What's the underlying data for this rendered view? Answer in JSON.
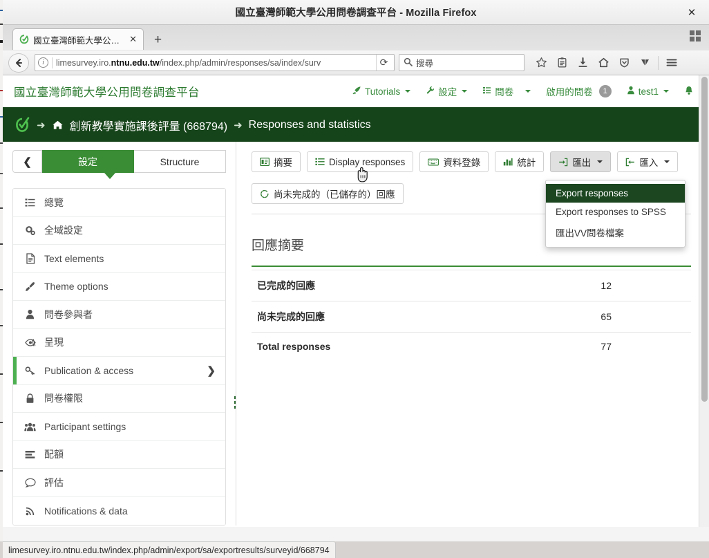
{
  "window": {
    "title": "國立臺灣師範大學公用問卷調查平台 - Mozilla Firefox",
    "close_label": "✕"
  },
  "browser": {
    "tab": {
      "title": "國立臺灣師範大學公…",
      "close_label": "✕",
      "favicon": "limesurvey-favicon-icon"
    },
    "new_tab_label": "+",
    "url": "limesurvey.iro.ntnu.edu.tw/index.php/admin/responses/sa/index/surv",
    "url_host_bold": "ntnu.edu.tw",
    "url_prefix": "limesurvey.iro.",
    "url_suffix": "/index.php/admin/responses/sa/index/surv",
    "reload_label": "⟳",
    "search_placeholder": "搜尋",
    "toolbar_icons": [
      "star-icon",
      "library-icon",
      "download-icon",
      "home-icon",
      "shield-icon",
      "pocket-icon",
      "hamburger-menu-icon"
    ]
  },
  "status_bar": {
    "link_preview": "limesurvey.iro.ntnu.edu.tw/index.php/admin/export/sa/exportresults/surveyid/668794"
  },
  "navbar": {
    "brand": "國立臺灣師範大學公用問卷調查平台",
    "items": [
      {
        "label": "Tutorials",
        "icon": "rocket-icon",
        "caret": true,
        "badge": null
      },
      {
        "label": "設定",
        "icon": "wrench-icon",
        "caret": true,
        "badge": null
      },
      {
        "label": "問卷",
        "icon": "list-icon",
        "caret": true,
        "badge": null
      },
      {
        "label": "啟用的問卷",
        "icon": null,
        "caret": false,
        "badge": "1"
      },
      {
        "label": "test1",
        "icon": "user-icon",
        "caret": true,
        "badge": null
      },
      {
        "label": "",
        "icon": "bell-icon",
        "caret": false,
        "badge": null
      }
    ]
  },
  "breadcrumb": {
    "logo": "limesurvey-logo-icon",
    "home_icon": "home-icon",
    "survey": "創新教學實施課後評量 (668794)",
    "current": "Responses and statistics",
    "separator": "➜"
  },
  "sidebar": {
    "collapse_label": "❮",
    "tabs": [
      {
        "label": "設定",
        "active": true
      },
      {
        "label": "Structure",
        "active": false
      }
    ],
    "items": [
      {
        "label": "總覽",
        "icon": "list-icon",
        "active": false,
        "chevron": false
      },
      {
        "label": "全域設定",
        "icon": "gears-icon",
        "active": false,
        "chevron": false
      },
      {
        "label": "Text elements",
        "icon": "file-text-icon",
        "active": false,
        "chevron": false
      },
      {
        "label": "Theme options",
        "icon": "paintbrush-icon",
        "active": false,
        "chevron": false
      },
      {
        "label": "問卷參與者",
        "icon": "user-icon",
        "active": false,
        "chevron": false
      },
      {
        "label": "呈現",
        "icon": "eye-slash-icon",
        "active": false,
        "chevron": false
      },
      {
        "label": "Publication & access",
        "icon": "key-icon",
        "active": true,
        "chevron": true
      },
      {
        "label": "問卷權限",
        "icon": "lock-icon",
        "active": false,
        "chevron": false
      },
      {
        "label": "Participant settings",
        "icon": "users-icon",
        "active": false,
        "chevron": false
      },
      {
        "label": "配額",
        "icon": "tasks-icon",
        "active": false,
        "chevron": false
      },
      {
        "label": "評估",
        "icon": "comment-icon",
        "active": false,
        "chevron": false
      },
      {
        "label": "Notifications & data",
        "icon": "rss-icon",
        "active": false,
        "chevron": false
      }
    ]
  },
  "toolbar": {
    "buttons": [
      {
        "label": "摘要",
        "icon": "summary-icon",
        "active": false,
        "caret": false
      },
      {
        "label": "Display responses",
        "icon": "list-icon",
        "active": false,
        "caret": false
      },
      {
        "label": "資料登錄",
        "icon": "keyboard-icon",
        "active": false,
        "caret": false
      },
      {
        "label": "統計",
        "icon": "bar-chart-icon",
        "active": false,
        "caret": false
      },
      {
        "label": "匯出",
        "icon": "export-icon",
        "active": true,
        "caret": true
      },
      {
        "label": "匯入",
        "icon": "import-icon",
        "active": false,
        "caret": true
      },
      {
        "label": "尚未完成的（已儲存的）回應",
        "icon": "saved-icon",
        "active": false,
        "caret": false
      }
    ]
  },
  "export_menu": {
    "items": [
      {
        "label": "Export responses",
        "highlighted": true
      },
      {
        "label": "Export responses to SPSS",
        "highlighted": false
      },
      {
        "label": "匯出VV問卷檔案",
        "highlighted": false
      }
    ]
  },
  "main": {
    "summary_title": "回應摘要",
    "table": {
      "rows": [
        {
          "label": "已完成的回應",
          "value": "12"
        },
        {
          "label": "尚未完成的回應",
          "value": "65"
        },
        {
          "label": "Total responses",
          "value": "77"
        }
      ]
    }
  },
  "colors": {
    "brand_green": "#3a8c35",
    "dark_green": "#16441a",
    "nav_green": "#3a8c3e",
    "active_marker": "#4caf50",
    "menu_highlight": "#1b4620"
  }
}
